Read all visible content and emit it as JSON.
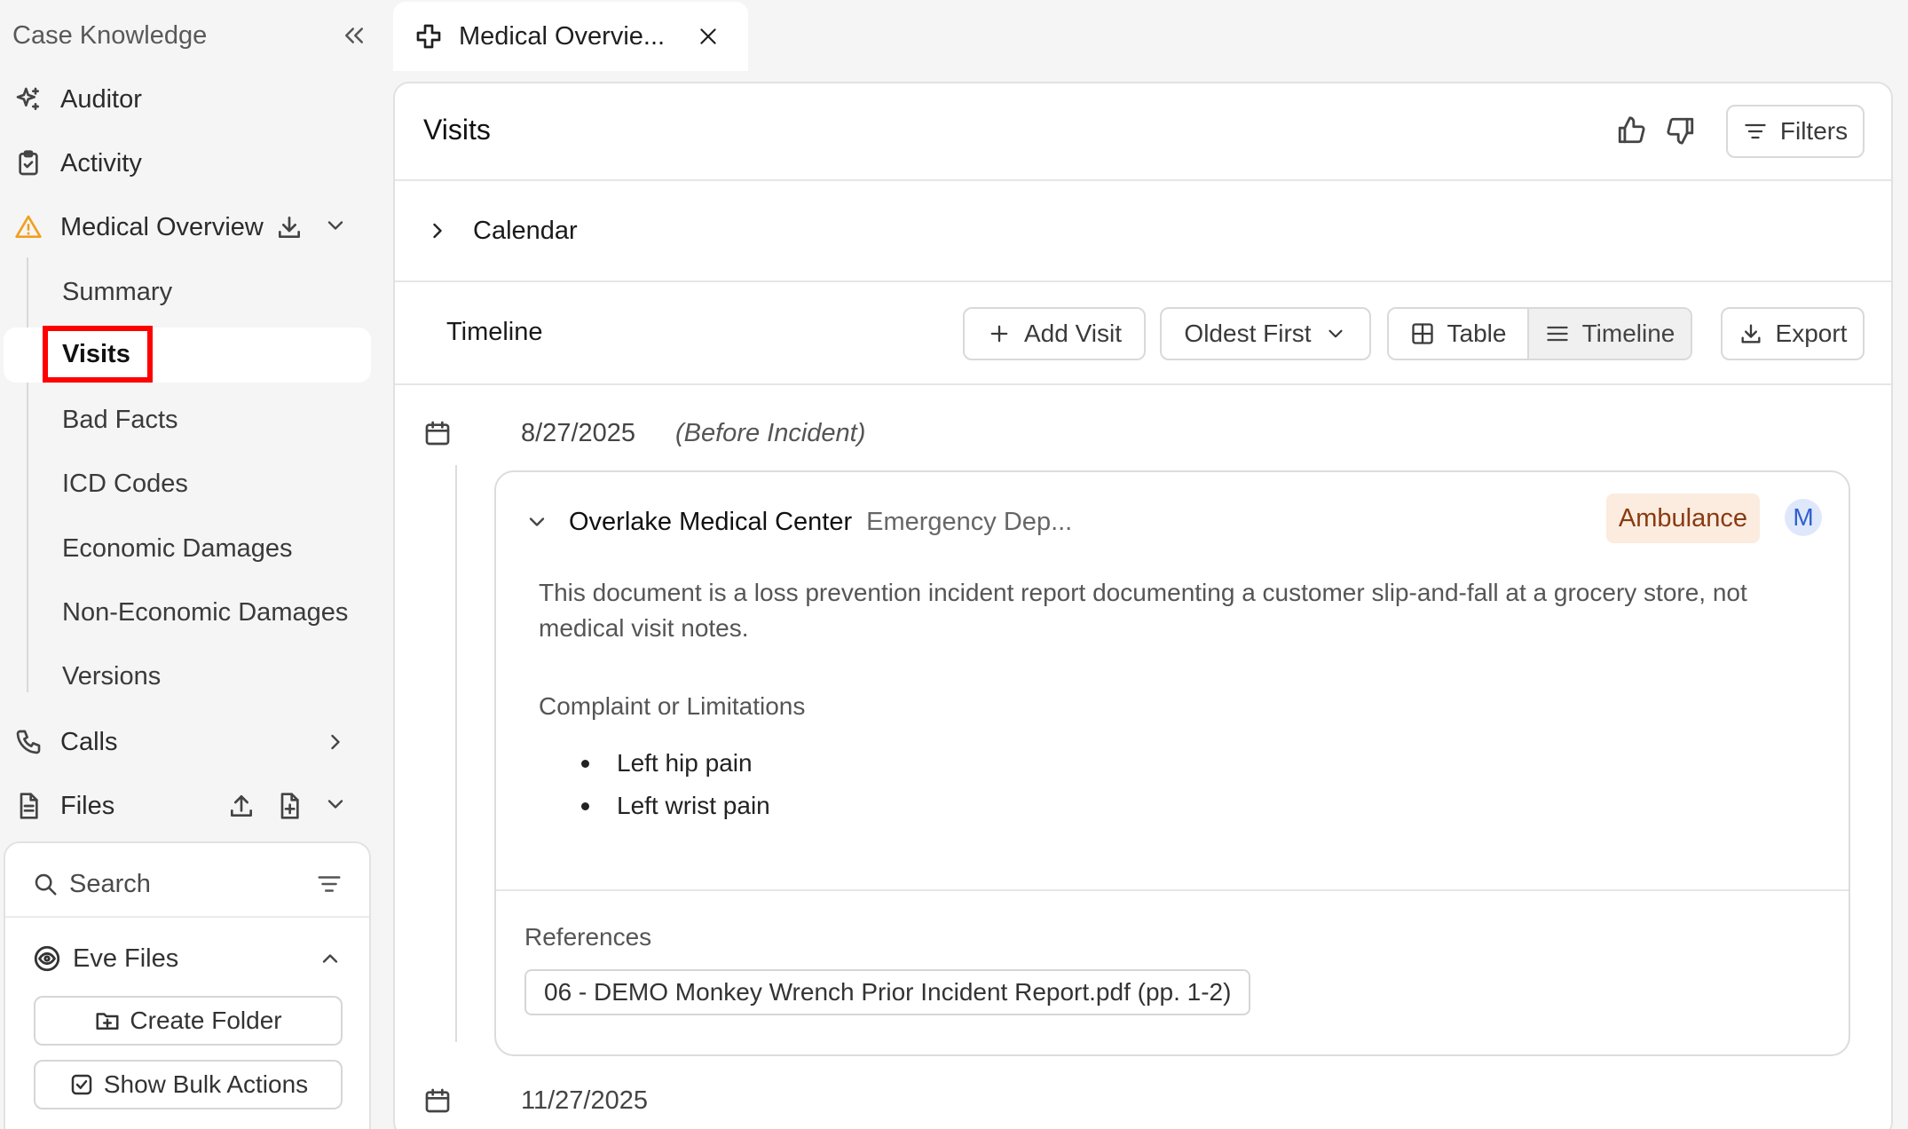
{
  "sidebar": {
    "header_title": "Case Knowledge",
    "items": {
      "auditor": "Auditor",
      "activity": "Activity",
      "medical_overview": "Medical Overview",
      "calls": "Calls",
      "files": "Files"
    },
    "medical_sub": {
      "summary": "Summary",
      "visits": "Visits",
      "bad_facts": "Bad Facts",
      "icd_codes": "ICD Codes",
      "economic_damages": "Economic Damages",
      "non_economic_damages": "Non-Economic Damages",
      "versions": "Versions"
    },
    "files_panel": {
      "search_label": "Search",
      "eve_files": "Eve Files",
      "create_folder": "Create Folder",
      "show_bulk_actions": "Show Bulk Actions"
    }
  },
  "tab": {
    "label": "Medical Overvie..."
  },
  "main": {
    "title": "Visits",
    "filters_label": "Filters",
    "calendar_label": "Calendar",
    "timeline_label": "Timeline",
    "add_visit_label": "Add Visit",
    "sort_label": "Oldest First",
    "view_table_label": "Table",
    "view_timeline_label": "Timeline",
    "export_label": "Export",
    "entries": [
      {
        "date": "8/27/2025",
        "note": "(Before Incident)",
        "facility": "Overlake Medical Center",
        "department": "Emergency Dep...",
        "badge": "Ambulance",
        "avatar": "M",
        "description": "This document is a loss prevention incident report documenting a customer slip-and-fall at a grocery store, not medical visit notes.",
        "subheading": "Complaint or Limitations",
        "complaints": [
          "Left hip pain",
          "Left wrist pain"
        ],
        "references_label": "References",
        "reference": "06 - DEMO Monkey Wrench Prior Incident Report.pdf (pp. 1-2)"
      },
      {
        "date": "11/27/2025"
      }
    ]
  },
  "colors": {
    "warning_icon": "#f0a020",
    "highlight_box": "#ff0000",
    "badge_bg": "#fbecdf",
    "badge_text": "#8a3a12",
    "avatar_text": "#2f5fd0"
  }
}
